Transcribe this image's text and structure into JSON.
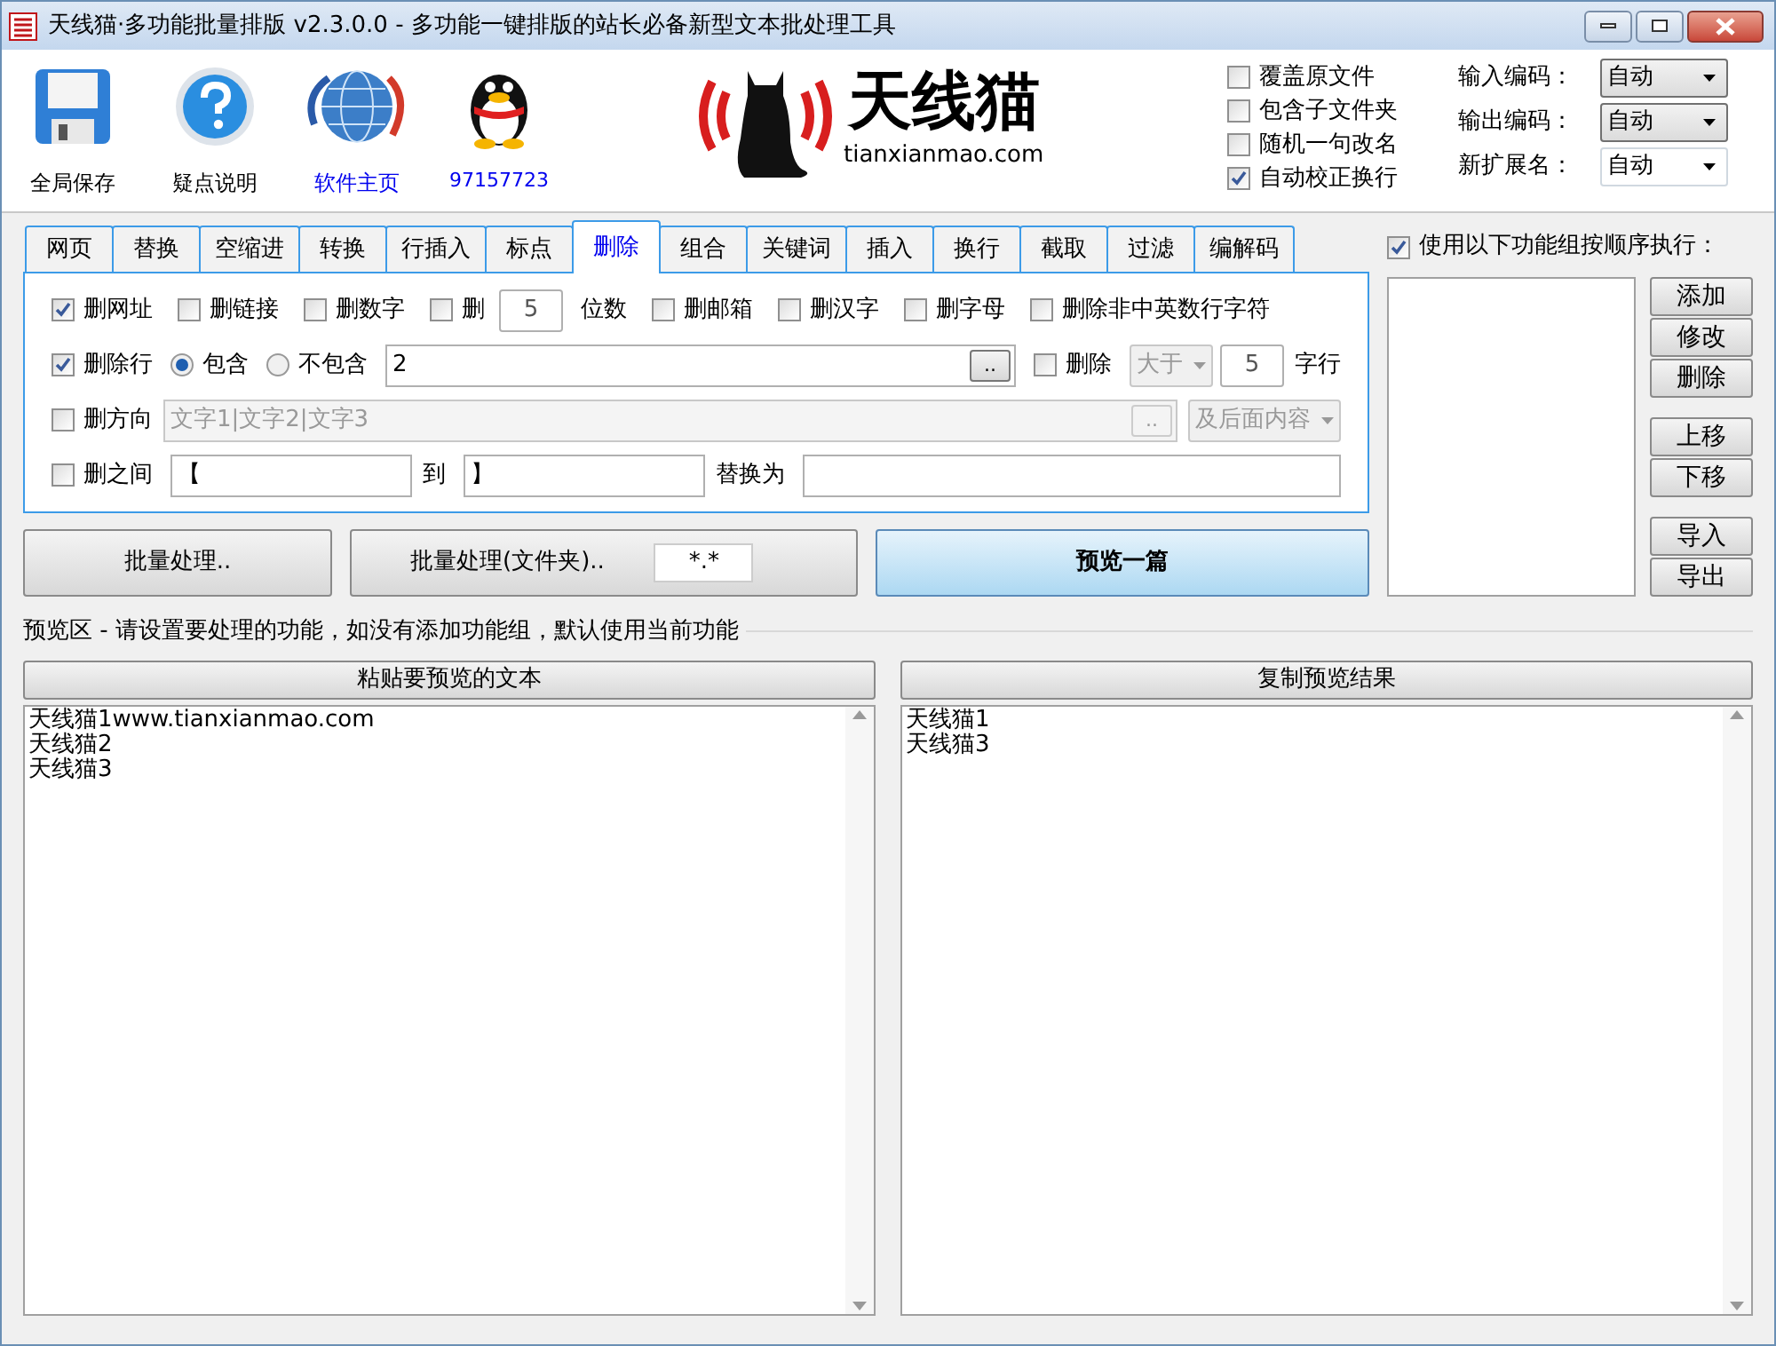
{
  "window": {
    "title": "天线猫·多功能批量排版 v2.3.0.0 - 多功能一键排版的站长必备新型文本批处理工具"
  },
  "toolbar": [
    {
      "kind": "save",
      "label": "全局保存",
      "link": false
    },
    {
      "kind": "help",
      "label": "疑点说明",
      "link": false
    },
    {
      "kind": "globe",
      "label": "软件主页",
      "link": true
    },
    {
      "kind": "penguin",
      "label": "97157723",
      "link": true
    }
  ],
  "logo": {
    "name": "天线猫",
    "domain": "tianxianmao.com"
  },
  "options": [
    {
      "label": "覆盖原文件",
      "checked": false
    },
    {
      "label": "包含子文件夹",
      "checked": false
    },
    {
      "label": "随机一句改名",
      "checked": false
    },
    {
      "label": "自动校正换行",
      "checked": true
    }
  ],
  "encodings": [
    {
      "label": "输入编码：",
      "value": "自动",
      "editable": false
    },
    {
      "label": "输出编码：",
      "value": "自动",
      "editable": false
    },
    {
      "label": "新扩展名：",
      "value": "自动",
      "editable": true
    }
  ],
  "tabs": [
    {
      "label": "网页",
      "selected": false
    },
    {
      "label": "替换",
      "selected": false
    },
    {
      "label": "空缩进",
      "selected": false
    },
    {
      "label": "转换",
      "selected": false
    },
    {
      "label": "行插入",
      "selected": false
    },
    {
      "label": "标点",
      "selected": false
    },
    {
      "label": "删除",
      "selected": true
    },
    {
      "label": "组合",
      "selected": false
    },
    {
      "label": "关键词",
      "selected": false
    },
    {
      "label": "插入",
      "selected": false
    },
    {
      "label": "换行",
      "selected": false
    },
    {
      "label": "截取",
      "selected": false
    },
    {
      "label": "过滤",
      "selected": false
    },
    {
      "label": "编解码",
      "selected": false
    }
  ],
  "panel_rows": [
    [
      {
        "kind": "checkbox",
        "label": "删网址",
        "checked": true
      },
      {
        "kind": "checkbox",
        "label": "删链接",
        "checked": false
      },
      {
        "kind": "checkbox",
        "label": "删数字",
        "checked": false
      },
      {
        "kind": "checkbox",
        "label": "删",
        "checked": false
      },
      {
        "kind": "number",
        "value": "5"
      },
      {
        "kind": "label",
        "text": "位数"
      },
      {
        "kind": "checkbox",
        "label": "删邮箱",
        "checked": false
      },
      {
        "kind": "checkbox",
        "label": "删汉字",
        "checked": false
      },
      {
        "kind": "checkbox",
        "label": "删字母",
        "checked": false
      },
      {
        "kind": "checkbox",
        "label": "删除非中英数行字符",
        "checked": false
      }
    ],
    [
      {
        "kind": "checkbox",
        "label": "删除行",
        "checked": true
      },
      {
        "kind": "radio",
        "label": "包含",
        "selected": true
      },
      {
        "kind": "radio",
        "label": "不包含",
        "selected": false
      },
      {
        "kind": "long_field",
        "value": "2",
        "browse": "..",
        "disabled": false
      },
      {
        "kind": "checkbox",
        "label": "删除",
        "checked": false
      },
      {
        "kind": "select",
        "value": "大于",
        "disabled": true
      },
      {
        "kind": "number",
        "value": "5"
      },
      {
        "kind": "label",
        "text": "字行"
      }
    ],
    [
      {
        "kind": "checkbox",
        "label": "删方向",
        "checked": false
      },
      {
        "kind": "long_field",
        "placeholder": "文字1|文字2|文字3",
        "browse": "..",
        "disabled": true
      },
      {
        "kind": "select",
        "value": "及后面内容",
        "disabled": true
      }
    ],
    [
      {
        "kind": "checkbox",
        "label": "删之间",
        "checked": false
      },
      {
        "kind": "field",
        "value": "【"
      },
      {
        "kind": "label",
        "text": "到"
      },
      {
        "kind": "field",
        "value": "】"
      },
      {
        "kind": "label",
        "text": "替换为"
      },
      {
        "kind": "long_field",
        "disabled": false
      }
    ]
  ],
  "actions": {
    "batch": "批量处理..",
    "batch_folder": "批量处理(文件夹)..",
    "pattern": "*.*",
    "preview": "预览一篇"
  },
  "sequence": {
    "label": "使用以下功能组按顺序执行：",
    "checked": true,
    "button_groups": [
      [
        "添加",
        "修改",
        "删除"
      ],
      [
        "上移",
        "下移"
      ],
      [
        "导入",
        "导出"
      ]
    ]
  },
  "preview": {
    "heading": "预览区 - 请设置要处理的功能，如没有添加功能组，默认使用当前功能",
    "panes": [
      {
        "button": "粘贴要预览的文本",
        "lines": [
          "天线猫1www.tianxianmao.com",
          "天线猫2",
          "天线猫3"
        ]
      },
      {
        "button": "复制预览结果",
        "lines": [
          "天线猫1",
          "天线猫3"
        ]
      }
    ]
  }
}
